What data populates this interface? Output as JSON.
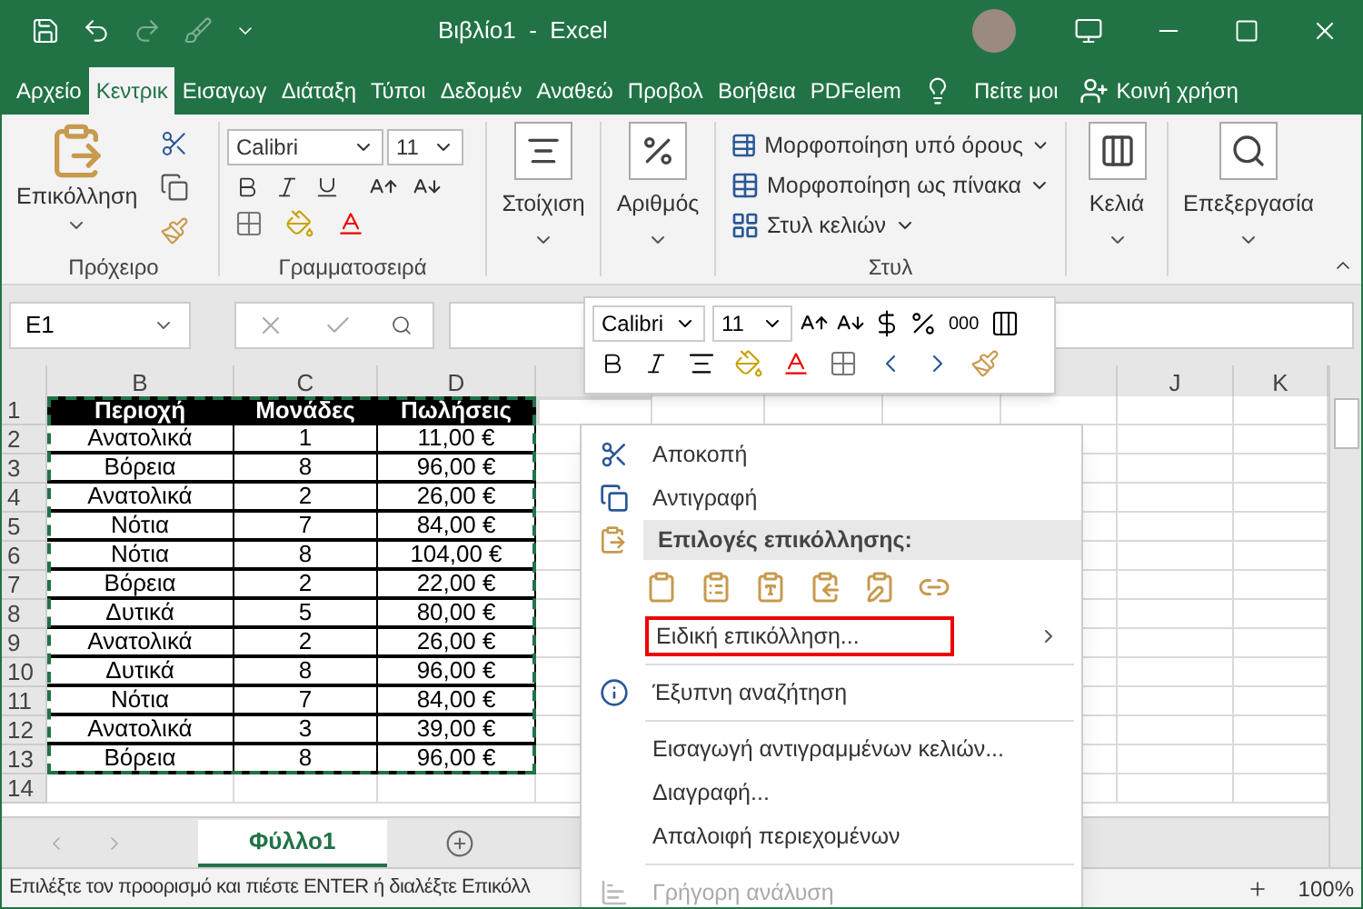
{
  "title_bar": {
    "title": "Βιβλίο1  -  Excel"
  },
  "ribbon_tabs": [
    {
      "label": "Αρχείο",
      "selected": false
    },
    {
      "label": "Κεντρικ",
      "selected": true
    },
    {
      "label": "Εισαγωγ",
      "selected": false
    },
    {
      "label": "Διάταξη",
      "selected": false
    },
    {
      "label": "Τύποι",
      "selected": false
    },
    {
      "label": "Δεδομέν",
      "selected": false
    },
    {
      "label": "Αναθεώ",
      "selected": false
    },
    {
      "label": "Προβολ",
      "selected": false
    },
    {
      "label": "Βοήθεια",
      "selected": false
    },
    {
      "label": "PDFelem",
      "selected": false
    }
  ],
  "tell_me": "Πείτε μοι",
  "share": "Κοινή χρήση",
  "ribbon": {
    "clipboard": {
      "paste": "Επικόλληση",
      "label": "Πρόχειρο"
    },
    "font": {
      "name": "Calibri",
      "size": "11",
      "label": "Γραμματοσειρά"
    },
    "alignment": "Στοίχιση",
    "number": "Αριθμός",
    "styles": {
      "items": [
        "Μορφοποίηση υπό όρους",
        "Μορφοποίηση ως πίνακα",
        "Στυλ κελιών"
      ],
      "label": "Στυλ"
    },
    "cells": "Κελιά",
    "editing": "Επεξεργασία"
  },
  "name_box": "E1",
  "column_headers": {
    "left": [
      "B",
      "C",
      "D"
    ],
    "right": [
      "J",
      "K"
    ]
  },
  "row_numbers": [
    "1",
    "2",
    "3",
    "4",
    "5",
    "6",
    "7",
    "8",
    "9",
    "10",
    "11",
    "12",
    "13",
    "14"
  ],
  "table": {
    "header": [
      "Περιοχή",
      "Μονάδες",
      "Πωλήσεις"
    ],
    "rows": [
      [
        "Ανατολικά",
        "1",
        "11,00 €"
      ],
      [
        "Βόρεια",
        "8",
        "96,00 €"
      ],
      [
        "Ανατολικά",
        "2",
        "26,00 €"
      ],
      [
        "Νότια",
        "7",
        "84,00 €"
      ],
      [
        "Νότια",
        "8",
        "104,00 €"
      ],
      [
        "Βόρεια",
        "2",
        "22,00 €"
      ],
      [
        "Δυτικά",
        "5",
        "80,00 €"
      ],
      [
        "Ανατολικά",
        "2",
        "26,00 €"
      ],
      [
        "Δυτικά",
        "8",
        "96,00 €"
      ],
      [
        "Νότια",
        "7",
        "84,00 €"
      ],
      [
        "Ανατολικά",
        "3",
        "39,00 €"
      ],
      [
        "Βόρεια",
        "8",
        "96,00 €"
      ]
    ]
  },
  "sheet_tabs": [
    {
      "label": "Φύλλο1",
      "selected": true
    }
  ],
  "status_bar": {
    "message": "Επιλέξτε τον προορισμό και πιέστε ENTER ή διαλέξτε Επικόλλ",
    "zoom": "100%"
  },
  "mini_toolbar": {
    "font": "Calibri",
    "size": "11",
    "thousands": "000"
  },
  "context_menu": [
    {
      "kind": "item",
      "label": "Αποκοπή",
      "disabled": false,
      "highlighted": false,
      "submenu": false
    },
    {
      "kind": "item",
      "label": "Αντιγραφή",
      "disabled": false,
      "highlighted": false,
      "submenu": false
    },
    {
      "kind": "header",
      "label": "Επιλογές επικόλλησης:"
    },
    {
      "kind": "paste_icons"
    },
    {
      "kind": "item",
      "label": "Ειδική επικόλληση...",
      "disabled": false,
      "highlighted": true,
      "submenu": true
    },
    {
      "kind": "separator"
    },
    {
      "kind": "item",
      "label": "Έξυπνη αναζήτηση",
      "disabled": false,
      "highlighted": false,
      "submenu": false
    },
    {
      "kind": "separator"
    },
    {
      "kind": "item",
      "label": "Εισαγωγή αντιγραμμένων κελιών...",
      "disabled": false,
      "highlighted": false,
      "submenu": false
    },
    {
      "kind": "item",
      "label": "Διαγραφή...",
      "disabled": false,
      "highlighted": false,
      "submenu": false
    },
    {
      "kind": "item",
      "label": "Απαλοιφή περιεχομένων",
      "disabled": false,
      "highlighted": false,
      "submenu": false
    },
    {
      "kind": "separator"
    },
    {
      "kind": "item",
      "label": "Γρήγορη ανάλυση",
      "disabled": true,
      "highlighted": false,
      "submenu": false
    }
  ]
}
